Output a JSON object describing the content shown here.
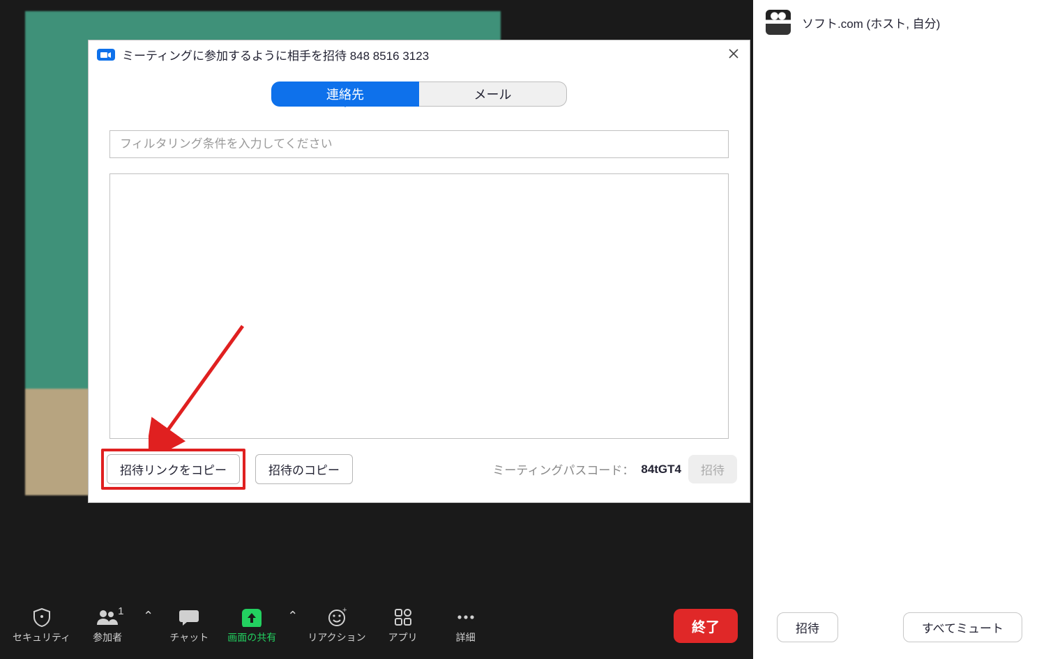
{
  "dialog": {
    "title": "ミーティングに参加するように相手を招待 848 8516 3123",
    "tabs": {
      "contacts": "連絡先",
      "email": "メール"
    },
    "filter_placeholder": "フィルタリング条件を入力してください",
    "copy_link": "招待リンクをコピー",
    "copy_invite": "招待のコピー",
    "passcode_label": "ミーティングパスコード：",
    "passcode_value": "84tGT4",
    "invite": "招待"
  },
  "participant": {
    "name": "ソフト.com (ホスト, 自分)"
  },
  "panel_footer": {
    "invite": "招待",
    "mute_all": "すべてミュート"
  },
  "toolbar": {
    "security": "セキュリティ",
    "participants": "参加者",
    "participants_count": "1",
    "chat": "チャット",
    "share": "画面の共有",
    "reactions": "リアクション",
    "apps": "アプリ",
    "more": "詳細",
    "end": "終了"
  }
}
